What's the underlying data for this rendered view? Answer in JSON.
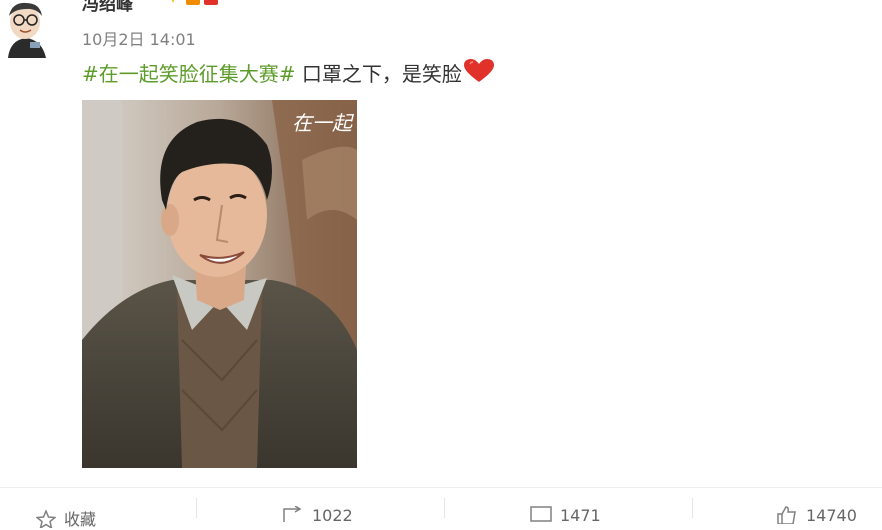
{
  "post": {
    "author": "冯绍峰",
    "timestamp": "10月2日 14:01",
    "hashtag": "#在一起笑脸征集大赛#",
    "text": " 口罩之下，是笑脸",
    "heart_icon": "heart-icon",
    "image_watermark": "在一起"
  },
  "actions": {
    "favorite_label": "收藏",
    "repost_count": "1022",
    "comment_count": "1471",
    "like_count": "14740"
  },
  "colors": {
    "hashtag": "#5d9c2a",
    "heart": "#e0312b",
    "timestamp": "#808080",
    "text": "#333333"
  }
}
